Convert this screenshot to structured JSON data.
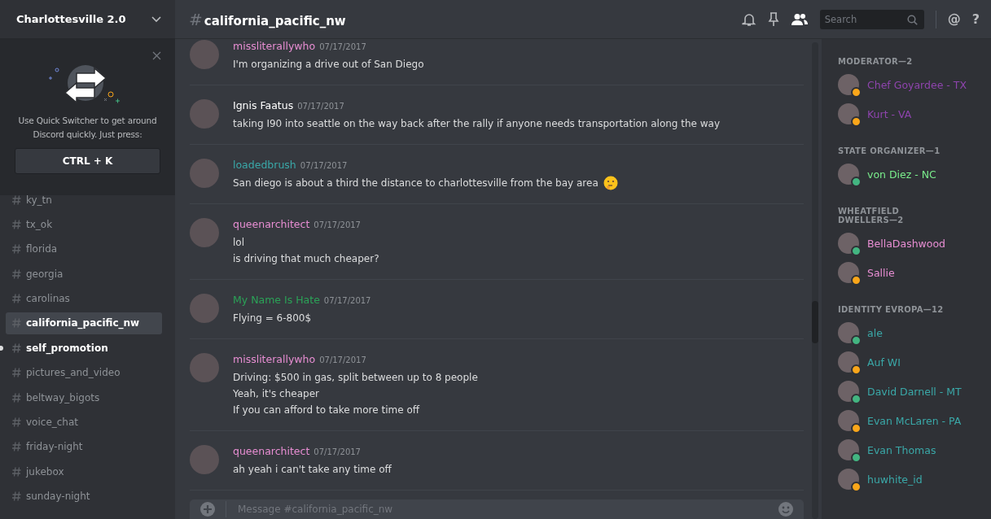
{
  "server": {
    "name": "Charlottesville 2.0"
  },
  "quick_switcher": {
    "text": "Use Quick Switcher to get around Discord quickly. Just press:",
    "shortcut": "CTRL + K"
  },
  "channels": [
    {
      "name": "ky_tn",
      "selected": false,
      "unread": false
    },
    {
      "name": "tx_ok",
      "selected": false,
      "unread": false
    },
    {
      "name": "florida",
      "selected": false,
      "unread": false
    },
    {
      "name": "georgia",
      "selected": false,
      "unread": false
    },
    {
      "name": "carolinas",
      "selected": false,
      "unread": false
    },
    {
      "name": "california_pacific_nw",
      "selected": true,
      "unread": false
    },
    {
      "name": "self_promotion",
      "selected": false,
      "unread": true
    },
    {
      "name": "pictures_and_video",
      "selected": false,
      "unread": false
    },
    {
      "name": "beltway_bigots",
      "selected": false,
      "unread": false
    },
    {
      "name": "voice_chat",
      "selected": false,
      "unread": false
    },
    {
      "name": "friday-night",
      "selected": false,
      "unread": false
    },
    {
      "name": "jukebox",
      "selected": false,
      "unread": false
    },
    {
      "name": "sunday-night",
      "selected": false,
      "unread": false
    }
  ],
  "header": {
    "hash": "#",
    "channel": "california_pacific_nw",
    "search": {
      "placeholder": "Search"
    },
    "at": "@",
    "help": "?"
  },
  "messages": [
    {
      "author": "missliterallywho",
      "color": "#e88ed3",
      "time": "07/17/2017",
      "lines": [
        {
          "text": "I'm organizing a drive out of San Diego"
        }
      ]
    },
    {
      "author": "Ignis Faatus",
      "color": "#ffffff",
      "time": "07/17/2017",
      "lines": [
        {
          "text": "taking I90 into seattle on the way back after the rally if anyone needs transportation along the way"
        }
      ]
    },
    {
      "author": "loadedbrush",
      "color": "#3aa8a8",
      "time": "07/17/2017",
      "lines": [
        {
          "text": "San diego is about a third the distance to charlottesville from the bay area",
          "emoji": true
        }
      ]
    },
    {
      "author": "queenarchitect",
      "color": "#e88ed3",
      "time": "07/17/2017",
      "lines": [
        {
          "text": "lol"
        },
        {
          "text": "is driving that much cheaper?"
        }
      ]
    },
    {
      "author": "My Name Is Hate",
      "color": "#2ba257",
      "time": "07/17/2017",
      "lines": [
        {
          "text": "Flying = 6-800$"
        }
      ]
    },
    {
      "author": "missliterallywho",
      "color": "#e88ed3",
      "time": "07/17/2017",
      "lines": [
        {
          "text": "Driving: $500 in gas, split between up to 8 people"
        },
        {
          "text": "Yeah, it's cheaper"
        },
        {
          "text": "If you can afford to take more time off"
        }
      ]
    },
    {
      "author": "queenarchitect",
      "color": "#e88ed3",
      "time": "07/17/2017",
      "lines": [
        {
          "text": "ah yeah i can't take any time off"
        }
      ]
    }
  ],
  "composer": {
    "placeholder": "Message #california_pacific_nw"
  },
  "member_groups": [
    {
      "title": "MODERATOR—2",
      "color": "#8e44ad",
      "members": [
        {
          "name": "Chef Goyardee - TX",
          "color": "#faa61a"
        },
        {
          "name": "Kurt - VA",
          "color": "#faa61a"
        }
      ]
    },
    {
      "title": "STATE ORGANIZER—1",
      "color": "#7aed8c",
      "members": [
        {
          "name": "von Diez - NC",
          "color": "#43b581"
        }
      ]
    },
    {
      "title": "WHEATFIELD DWELLERS—2",
      "color": "#e88ed3",
      "members": [
        {
          "name": "BellaDashwood",
          "color": "#43b581"
        },
        {
          "name": "Sallie",
          "color": "#faa61a"
        }
      ]
    },
    {
      "title": "IDENTITY EVROPA—12",
      "color": "#3aa8a8",
      "members": [
        {
          "name": "ale",
          "color": "#43b581"
        },
        {
          "name": "Auf WI",
          "color": "#faa61a"
        },
        {
          "name": "David Darnell - MT",
          "color": "#43b581"
        },
        {
          "name": "Evan McLaren - PA",
          "color": "#faa61a"
        },
        {
          "name": "Evan Thomas",
          "color": "#43b581"
        },
        {
          "name": "huwhite_id",
          "color": "#faa61a"
        }
      ]
    }
  ]
}
